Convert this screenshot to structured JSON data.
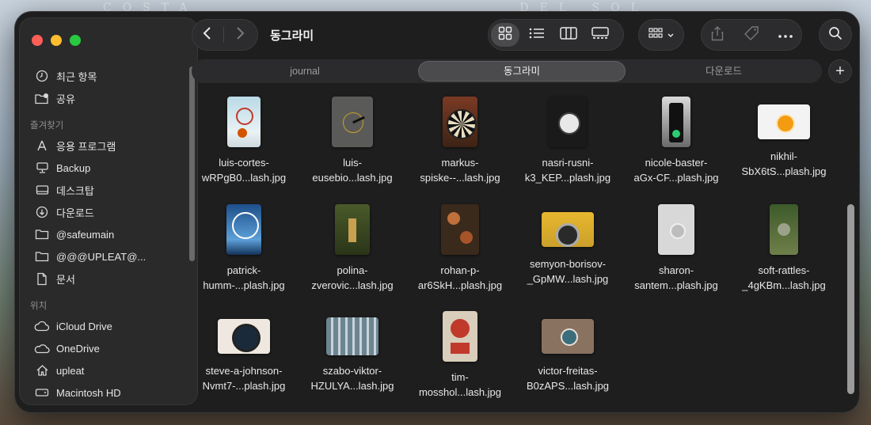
{
  "window": {
    "title": "동그라미"
  },
  "sidebar": {
    "recents": [
      {
        "label": "최근 항목",
        "icon": "clock-icon"
      },
      {
        "label": "공유",
        "icon": "shared-folder-icon"
      }
    ],
    "favorites_header": "즐겨찾기",
    "favorites": [
      {
        "label": "응용 프로그램",
        "icon": "applications-icon"
      },
      {
        "label": "Backup",
        "icon": "desktop-computer-icon"
      },
      {
        "label": "데스크탑",
        "icon": "desktop-icon"
      },
      {
        "label": "다운로드",
        "icon": "download-icon"
      },
      {
        "label": "@safeumain",
        "icon": "folder-icon"
      },
      {
        "label": "@@@UPLEAT@...",
        "icon": "folder-icon"
      },
      {
        "label": "문서",
        "icon": "document-icon"
      }
    ],
    "locations_header": "위치",
    "locations": [
      {
        "label": "iCloud Drive",
        "icon": "cloud-icon"
      },
      {
        "label": "OneDrive",
        "icon": "onedrive-icon"
      },
      {
        "label": "upleat",
        "icon": "home-icon"
      },
      {
        "label": "Macintosh HD",
        "icon": "harddisk-icon"
      }
    ]
  },
  "tabs": [
    {
      "label": "journal"
    },
    {
      "label": "동그라미"
    },
    {
      "label": "다운로드"
    }
  ],
  "active_tab": "동그라미",
  "files": [
    {
      "line1": "luis-cortes-",
      "line2": "wRPgB0...lash.jpg",
      "art": "basketball"
    },
    {
      "line1": "luis-",
      "line2": "eusebio...lash.jpg",
      "art": "clockface"
    },
    {
      "line1": "markus-",
      "line2": "spiske--...lash.jpg",
      "art": "dartboard"
    },
    {
      "line1": "nasri-rusni-",
      "line2": "k3_KEP...plash.jpg",
      "art": "streetclock"
    },
    {
      "line1": "nicole-baster-",
      "line2": "aGx-CF...plash.jpg",
      "art": "trafficlight"
    },
    {
      "line1": "nikhil-",
      "line2": "SbX6tS...plash.jpg",
      "art": "orange"
    },
    {
      "line1": "patrick-",
      "line2": "humm-...plash.jpg",
      "art": "ferriswheel"
    },
    {
      "line1": "polina-",
      "line2": "zverovic...lash.jpg",
      "art": "lamps"
    },
    {
      "line1": "rohan-p-",
      "line2": "ar6SkH...plash.jpg",
      "art": "food"
    },
    {
      "line1": "semyon-borisov-",
      "line2": "_GpMW...lash.jpg",
      "art": "car"
    },
    {
      "line1": "sharon-",
      "line2": "santem...plash.jpg",
      "art": "button"
    },
    {
      "line1": "soft-rattles-",
      "line2": "_4gKBm...lash.jpg",
      "art": "aerial"
    },
    {
      "line1": "steve-a-johnson-",
      "line2": "Nvmt7-...plash.jpg",
      "art": "lens"
    },
    {
      "line1": "szabo-viktor-",
      "line2": "HZULYA...lash.jpg",
      "art": "building"
    },
    {
      "line1": "tim-",
      "line2": "mosshol...lash.jpg",
      "art": "sign"
    },
    {
      "line1": "victor-freitas-",
      "line2": "B0zAPS...lash.jpg",
      "art": "eye"
    }
  ],
  "colors": {
    "window_bg": "#1e1e1e",
    "sidebar_bg": "#2a2a2b",
    "accent_active_tab": "#4b4b4d"
  }
}
